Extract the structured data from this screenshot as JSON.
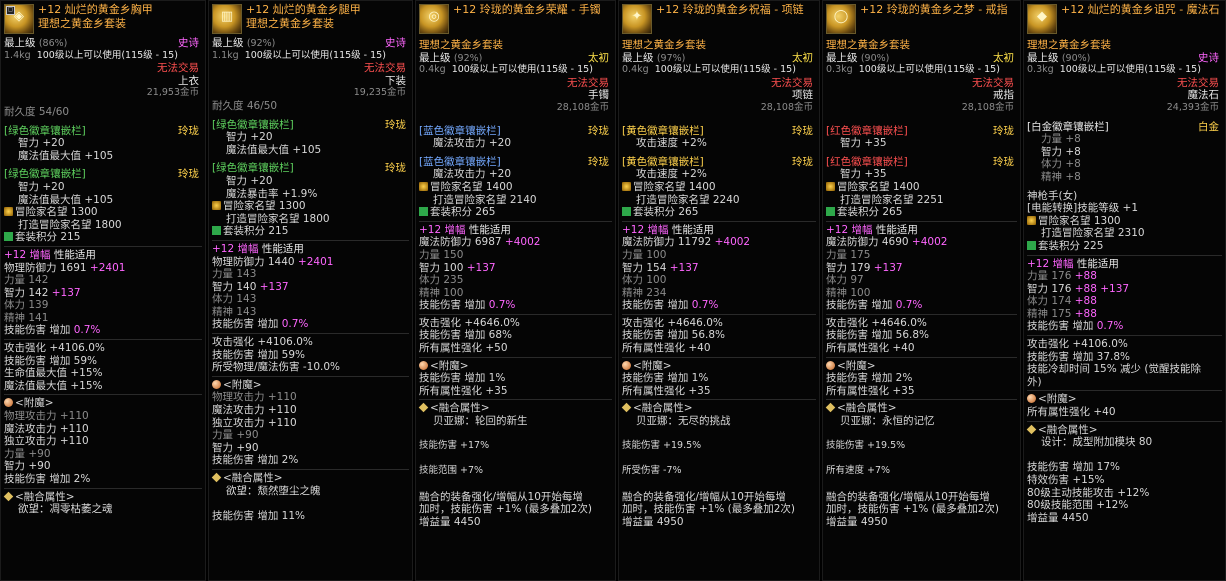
{
  "panels": [
    {
      "title1": "+12 灿烂的黄金乡胸甲",
      "title2": "理想之黄金乡套装",
      "grade": "最上级",
      "grade_pct": "(86%)",
      "rarity": "史诗",
      "weight": "1.4kg",
      "level_req": "100级以上可以使用(115级 - 15)",
      "trade": "无法交易",
      "slot": "上衣",
      "price": "21,953金币",
      "durability": "耐久度 54/60",
      "sockets": [
        {
          "name": "[绿色徽章镶嵌栏]",
          "grade": "玲珑",
          "lines": [
            "智力 +20",
            "魔法值最大值 +105"
          ]
        },
        {
          "name": "[绿色徽章镶嵌栏]",
          "grade": "玲珑",
          "lines": [
            "智力 +20",
            "魔法值最大值 +105"
          ]
        }
      ],
      "fame_label": "冒险家名望 1300",
      "forge_fame": "打造冒险家名望 1800",
      "set_score": "套装积分 215",
      "amp_prefix": "+12",
      "amp_label": "增幅",
      "amp_rule": "性能适用",
      "def_label": "物理防御力 1691",
      "def_bonus": "+2401",
      "stats": [
        {
          "k": "力量 142",
          "v": ""
        },
        {
          "k": "智力 142",
          "v": "+137"
        },
        {
          "k": "体力 139",
          "v": ""
        },
        {
          "k": "精神 141",
          "v": ""
        }
      ],
      "skill_dmg": "技能伤害 增加",
      "skill_dmg_v": "0.7%",
      "effects": [
        "攻击强化 +4106.0%",
        "技能伤害 增加 59%",
        "生命值最大值 +15%",
        "魔法值最大值 +15%"
      ],
      "enchant_title": "<附魔>",
      "enchant_lines": [
        "物理攻击力 +110",
        "魔法攻击力 +110",
        "独立攻击力 +110",
        "力量 +90",
        "智力 +90",
        "技能伤害 增加 2%"
      ],
      "fusion_title": "<融合属性>",
      "fusion_lines": [
        "欲望：凋零枯萎之魂"
      ]
    },
    {
      "title1": "+12 灿烂的黄金乡腿甲",
      "title2": "理想之黄金乡套装",
      "grade": "最上级",
      "grade_pct": "(92%)",
      "rarity": "史诗",
      "weight": "1.1kg",
      "level_req": "100级以上可以使用(115级 - 15)",
      "trade": "无法交易",
      "slot": "下装",
      "price": "19,235金币",
      "durability": "耐久度 46/50",
      "sockets": [
        {
          "name": "[绿色徽章镶嵌栏]",
          "grade": "玲珑",
          "lines": [
            "智力 +20",
            "魔法值最大值 +105"
          ]
        },
        {
          "name": "[绿色徽章镶嵌栏]",
          "grade": "玲珑",
          "lines": [
            "智力 +20",
            "魔法暴击率 +1.9%"
          ]
        }
      ],
      "fame_label": "冒险家名望 1300",
      "forge_fame": "打造冒险家名望 1800",
      "set_score": "套装积分 215",
      "amp_prefix": "+12",
      "amp_label": "增幅",
      "amp_rule": "性能适用",
      "def_label": "物理防御力 1440",
      "def_bonus": "+2401",
      "stats": [
        {
          "k": "力量 143",
          "v": ""
        },
        {
          "k": "智力 140",
          "v": "+137"
        },
        {
          "k": "体力 143",
          "v": ""
        },
        {
          "k": "精神 143",
          "v": ""
        }
      ],
      "skill_dmg": "技能伤害 增加",
      "skill_dmg_v": "0.7%",
      "effects": [
        "攻击强化 +4106.0%",
        "技能伤害 增加 59%",
        "所受物理/魔法伤害 -10.0%"
      ],
      "enchant_title": "<附魔>",
      "enchant_lines": [
        "物理攻击力 +110",
        "魔法攻击力 +110",
        "独立攻击力 +110",
        "力量 +90",
        "智力 +90",
        "技能伤害 增加 2%"
      ],
      "fusion_title": "<融合属性>",
      "fusion_lines": [
        "欲望：颓然堕尘之魄",
        "",
        "技能伤害 增加 11%"
      ]
    },
    {
      "title1": "+12 玲珑的黄金乡荣耀 - 手镯",
      "title2": "理想之黄金乡套装",
      "grade": "最上级",
      "grade_pct": "(92%)",
      "rarity": "太初",
      "weight": "0.4kg",
      "level_req": "100级以上可以使用(115级 - 15)",
      "trade": "无法交易",
      "slot": "手镯",
      "price": "28,108金币",
      "durability": "",
      "sockets": [
        {
          "name": "[蓝色徽章镶嵌栏]",
          "grade": "玲珑",
          "lines": [
            "魔法攻击力 +20"
          ]
        },
        {
          "name": "[蓝色徽章镶嵌栏]",
          "grade": "玲珑",
          "lines": [
            "魔法攻击力 +20"
          ]
        }
      ],
      "fame_label": "冒险家名望 1400",
      "forge_fame": "打造冒险家名望 2140",
      "set_score": "套装积分 265",
      "amp_prefix": "+12",
      "amp_label": "增幅",
      "amp_rule": "性能适用",
      "def_label": "魔法防御力 6987",
      "def_bonus": "+4002",
      "stats": [
        {
          "k": "力量 150",
          "v": ""
        },
        {
          "k": "智力 100",
          "v": "+137"
        },
        {
          "k": "体力 235",
          "v": ""
        },
        {
          "k": "精神 100",
          "v": ""
        }
      ],
      "skill_dmg": "技能伤害 增加",
      "skill_dmg_v": "0.7%",
      "effects": [
        "攻击强化 +4646.0%",
        "技能伤害 增加 68%",
        "所有属性强化 +50"
      ],
      "enchant_title": "<附魔>",
      "enchant_lines": [
        "技能伤害 增加 1%",
        "所有属性强化 +35"
      ],
      "fusion_title": "<融合属性>",
      "fusion_lines": [
        "贝亚娜：轮回的新生",
        "",
        "技能伤害 +17%",
        "",
        "技能范围 +7%",
        "",
        "融合的装备强化/增幅从10开始每增",
        "加时，技能伤害 +1% (最多叠加2次)",
        "增益量 4450"
      ]
    },
    {
      "title1": "+12 玲珑的黄金乡祝福 - 项链",
      "title2": "理想之黄金乡套装",
      "grade": "最上级",
      "grade_pct": "(97%)",
      "rarity": "太初",
      "weight": "0.4kg",
      "level_req": "100级以上可以使用(115级 - 15)",
      "trade": "无法交易",
      "slot": "项链",
      "price": "28,108金币",
      "durability": "",
      "sockets": [
        {
          "name": "[黄色徽章镶嵌栏]",
          "grade": "玲珑",
          "lines": [
            "攻击速度 +2%"
          ]
        },
        {
          "name": "[黄色徽章镶嵌栏]",
          "grade": "玲珑",
          "lines": [
            "攻击速度 +2%"
          ]
        }
      ],
      "fame_label": "冒险家名望 1400",
      "forge_fame": "打造冒险家名望 2240",
      "set_score": "套装积分 265",
      "amp_prefix": "+12",
      "amp_label": "增幅",
      "amp_rule": "性能适用",
      "def_label": "魔法防御力 11792",
      "def_bonus": "+4002",
      "stats": [
        {
          "k": "力量 100",
          "v": ""
        },
        {
          "k": "智力 154",
          "v": "+137"
        },
        {
          "k": "体力 100",
          "v": ""
        },
        {
          "k": "精神 234",
          "v": ""
        }
      ],
      "skill_dmg": "技能伤害 增加",
      "skill_dmg_v": "0.7%",
      "effects": [
        "攻击强化 +4646.0%",
        "技能伤害 增加 56.8%",
        "所有属性强化 +40"
      ],
      "enchant_title": "<附魔>",
      "enchant_lines": [
        "技能伤害 增加 1%",
        "所有属性强化 +35"
      ],
      "fusion_title": "<融合属性>",
      "fusion_lines": [
        "贝亚娜：无尽的挑战",
        "",
        "技能伤害 +19.5%",
        "",
        "所受伤害 -7%",
        "",
        "融合的装备强化/增幅从10开始每增",
        "加时，技能伤害 +1% (最多叠加2次)",
        "增益量 4950"
      ]
    },
    {
      "title1": "+12 玲珑的黄金乡之梦 - 戒指",
      "title2": "理想之黄金乡套装",
      "grade": "最上级",
      "grade_pct": "(90%)",
      "rarity": "太初",
      "weight": "0.3kg",
      "level_req": "100级以上可以使用(115级 - 15)",
      "trade": "无法交易",
      "slot": "戒指",
      "price": "28,108金币",
      "durability": "",
      "sockets": [
        {
          "name": "[红色徽章镶嵌栏]",
          "grade": "玲珑",
          "lines": [
            "智力 +35"
          ]
        },
        {
          "name": "[红色徽章镶嵌栏]",
          "grade": "玲珑",
          "lines": [
            "智力 +35"
          ]
        }
      ],
      "fame_label": "冒险家名望 1400",
      "forge_fame": "打造冒险家名望 2251",
      "set_score": "套装积分 265",
      "amp_prefix": "+12",
      "amp_label": "增幅",
      "amp_rule": "性能适用",
      "def_label": "魔法防御力 4690",
      "def_bonus": "+4002",
      "stats": [
        {
          "k": "力量 175",
          "v": ""
        },
        {
          "k": "智力 179",
          "v": "+137"
        },
        {
          "k": "体力 97",
          "v": ""
        },
        {
          "k": "精神 100",
          "v": ""
        }
      ],
      "skill_dmg": "技能伤害 增加",
      "skill_dmg_v": "0.7%",
      "effects": [
        "攻击强化 +4646.0%",
        "技能伤害 增加 56.8%",
        "所有属性强化 +40"
      ],
      "enchant_title": "<附魔>",
      "enchant_lines": [
        "技能伤害 增加 2%",
        "所有属性强化 +35"
      ],
      "fusion_title": "<融合属性>",
      "fusion_lines": [
        "贝亚娜：永恒的记忆",
        "",
        "技能伤害 +19.5%",
        "",
        "所有速度 +7%",
        "",
        "融合的装备强化/增幅从10开始每增",
        "加时，技能伤害 +1% (最多叠加2次)",
        "增益量 4950"
      ]
    },
    {
      "title1": "+12 灿烂的黄金乡诅咒 - 魔法石",
      "title2": "理想之黄金乡套装",
      "grade": "最上级",
      "grade_pct": "(90%)",
      "rarity": "史诗",
      "weight": "0.3kg",
      "level_req": "100级以上可以使用(115级 - 15)",
      "trade": "无法交易",
      "slot": "魔法石",
      "price": "24,393金币",
      "durability": "",
      "platinum": {
        "name": "[白金徽章镶嵌栏]",
        "grade": "白金",
        "lines": [
          "力量 +8",
          "智力 +8",
          "体力 +8",
          "精神 +8"
        ]
      },
      "special_title": "神枪手(女)",
      "special_line": "[电能转换]技能等级 +1",
      "fame_label": "冒险家名望 1300",
      "forge_fame": "打造冒险家名望 2310",
      "set_score": "套装积分 225",
      "amp_prefix": "+12",
      "amp_label": "增幅",
      "amp_rule": "性能适用",
      "stats6": [
        {
          "k": "力量 176",
          "v": "+88"
        },
        {
          "k": "智力 176",
          "v": "+88 +137"
        },
        {
          "k": "体力 174",
          "v": "+88"
        },
        {
          "k": "精神 175",
          "v": "+88"
        }
      ],
      "skill_dmg": "技能伤害 增加",
      "skill_dmg_v": "0.7%",
      "effects": [
        "攻击强化 +4106.0%",
        "技能伤害 增加 37.8%",
        "技能冷却时间 15% 减少 (觉醒技能除",
        "外)"
      ],
      "enchant_title": "<附魔>",
      "enchant_lines": [
        "所有属性强化 +40"
      ],
      "fusion_title": "<融合属性>",
      "fusion_lines": [
        "设计：成型附加模块 80",
        "",
        "技能伤害 增加 17%",
        "特效伤害 +15%",
        "80级主动技能攻击 +12%",
        "80级技能范围 +12%",
        "增益量 4450"
      ]
    }
  ]
}
